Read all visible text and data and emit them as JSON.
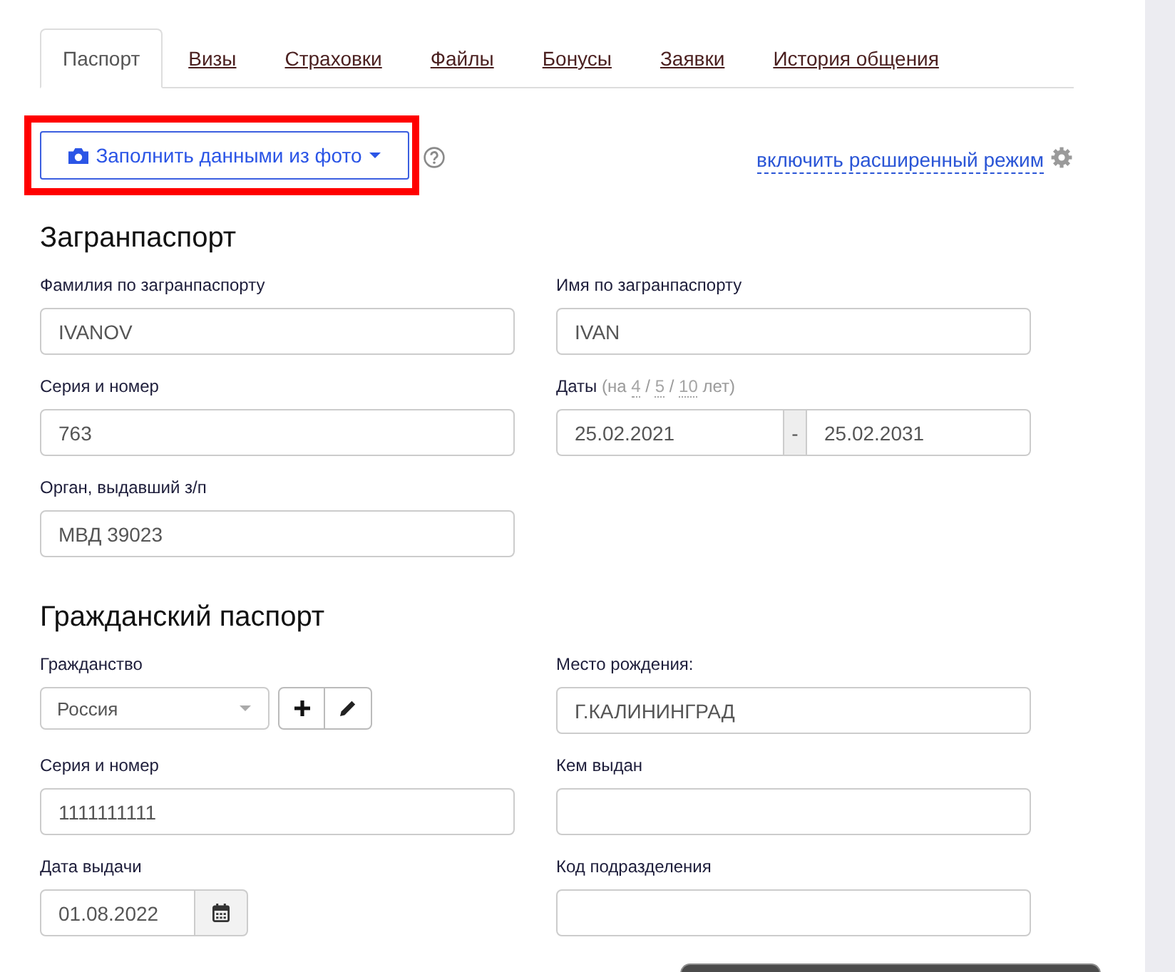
{
  "tabs": [
    {
      "label": "Паспорт",
      "selected": true
    },
    {
      "label": "Визы",
      "selected": false
    },
    {
      "label": "Страховки",
      "selected": false
    },
    {
      "label": "Файлы",
      "selected": false
    },
    {
      "label": "Бонусы",
      "selected": false
    },
    {
      "label": "Заявки",
      "selected": false
    },
    {
      "label": "История общения",
      "selected": false
    }
  ],
  "toolbar": {
    "fill_button": {
      "label": "Заполнить данными из фото",
      "highlighted": true
    },
    "advanced_mode_link": "включить расширенный режим"
  },
  "sections": [
    {
      "title": "Загранпаспорт",
      "rows": [
        [
          {
            "kind": "text",
            "label": "Фамилия по загранпаспорту",
            "value": "IVANOV"
          },
          {
            "kind": "text",
            "label": "Имя по загранпаспорту",
            "value": "IVAN"
          }
        ],
        [
          {
            "kind": "text",
            "label": "Серия и номер",
            "value": "763"
          },
          {
            "kind": "date_range",
            "label": "Даты",
            "hint": {
              "open": "(на",
              "terms": [
                "4",
                "5",
                "10"
              ],
              "separator": "/",
              "close": "лет)"
            },
            "from": "25.02.2021",
            "range_separator": "-",
            "to": "25.02.2031"
          }
        ],
        [
          {
            "kind": "text",
            "label": "Орган, выдавший з/п",
            "value": "МВД 39023"
          }
        ]
      ]
    },
    {
      "title": "Гражданский паспорт",
      "rows": [
        [
          {
            "kind": "select",
            "label": "Гражданство",
            "value": "Россия"
          },
          {
            "kind": "text",
            "label": "Место рождения:",
            "value": "Г.КАЛИНИНГРАД"
          }
        ],
        [
          {
            "kind": "text",
            "label": "Серия и номер",
            "value": "1111111111"
          },
          {
            "kind": "text",
            "label": "Кем выдан"
          }
        ],
        [
          {
            "kind": "date",
            "label": "Дата выдачи",
            "value": "01.08.2022"
          },
          {
            "kind": "text",
            "label": "Код подразделения"
          }
        ]
      ]
    }
  ]
}
